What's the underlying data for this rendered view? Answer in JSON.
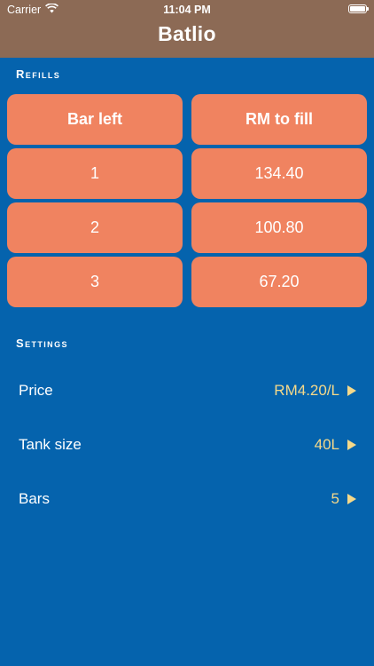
{
  "status_bar": {
    "carrier": "Carrier",
    "time": "11:04 PM"
  },
  "header": {
    "title": "Batlio"
  },
  "refills": {
    "title": "Refills",
    "columns": [
      "Bar left",
      "RM to fill"
    ],
    "rows": [
      {
        "bar_left": "1",
        "rm_to_fill": "134.40"
      },
      {
        "bar_left": "2",
        "rm_to_fill": "100.80"
      },
      {
        "bar_left": "3",
        "rm_to_fill": "67.20"
      }
    ]
  },
  "settings": {
    "title": "Settings",
    "items": [
      {
        "label": "Price",
        "value": "RM4.20/L"
      },
      {
        "label": "Tank size",
        "value": "40L"
      },
      {
        "label": "Bars",
        "value": "5"
      }
    ]
  },
  "colors": {
    "background": "#0563ad",
    "header": "#8c6a55",
    "cell": "#f08360",
    "value_text": "#f5d98a"
  },
  "icons": [
    "wifi-icon",
    "battery-icon",
    "play-arrow-icon"
  ]
}
